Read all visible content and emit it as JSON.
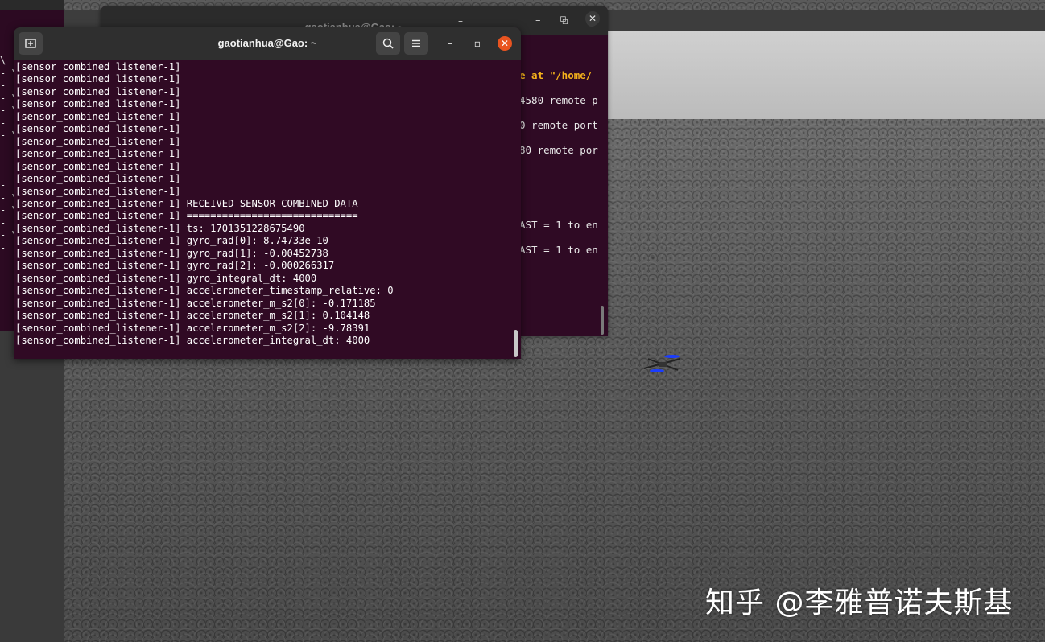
{
  "front_terminal": {
    "title": "gaotianhua@Gao: ~",
    "lines": [
      "[sensor_combined_listener-1]",
      "[sensor_combined_listener-1]",
      "[sensor_combined_listener-1]",
      "[sensor_combined_listener-1]",
      "[sensor_combined_listener-1]",
      "[sensor_combined_listener-1]",
      "[sensor_combined_listener-1]",
      "[sensor_combined_listener-1]",
      "[sensor_combined_listener-1]",
      "[sensor_combined_listener-1]",
      "[sensor_combined_listener-1]",
      "[sensor_combined_listener-1] RECEIVED SENSOR COMBINED DATA",
      "[sensor_combined_listener-1] =============================",
      "[sensor_combined_listener-1] ts: 1701351228675490",
      "[sensor_combined_listener-1] gyro_rad[0]: 8.74733e-10",
      "[sensor_combined_listener-1] gyro_rad[1]: -0.00452738",
      "[sensor_combined_listener-1] gyro_rad[2]: -0.000266317",
      "[sensor_combined_listener-1] gyro_integral_dt: 4000",
      "[sensor_combined_listener-1] accelerometer_timestamp_relative: 0",
      "[sensor_combined_listener-1] accelerometer_m_s2[0]: -0.171185",
      "[sensor_combined_listener-1] accelerometer_m_s2[1]: 0.104148",
      "[sensor_combined_listener-1] accelerometer_m_s2[2]: -9.78391",
      "[sensor_combined_listener-1] accelerometer_integral_dt: 4000"
    ],
    "icons": {
      "new_tab": "new-tab-icon",
      "search": "search-icon",
      "menu": "hamburger-menu-icon",
      "minimize": "minimize-icon",
      "maximize": "maximize-icon",
      "close": "close-icon"
    },
    "colors": {
      "background": "#300a24",
      "close": "#e95420"
    }
  },
  "back_terminal": {
    "title": "gaotianhua@Gao: ~",
    "lines": [
      {
        "text": "e at \"/home/",
        "highlight": true
      },
      {
        "text": "4580 remote p",
        "highlight": false
      },
      {
        "text": "0 remote port",
        "highlight": false
      },
      {
        "text": "80 remote por",
        "highlight": false
      },
      {
        "text": "",
        "highlight": false
      },
      {
        "text": "",
        "highlight": false
      },
      {
        "text": "AST = 1 to en",
        "highlight": false
      },
      {
        "text": "AST = 1 to en",
        "highlight": false
      }
    ]
  },
  "left_slice": {
    "glyphs": [
      "\\",
      "- \\",
      "- (",
      "- \\",
      "- \\",
      "- (",
      "- \\",
      "",
      "",
      "",
      "- [",
      "- \\",
      "- \\",
      "- (",
      "- \\",
      "- ("
    ]
  },
  "watermark": {
    "text": "知乎 @李雅普诺夫斯基"
  }
}
